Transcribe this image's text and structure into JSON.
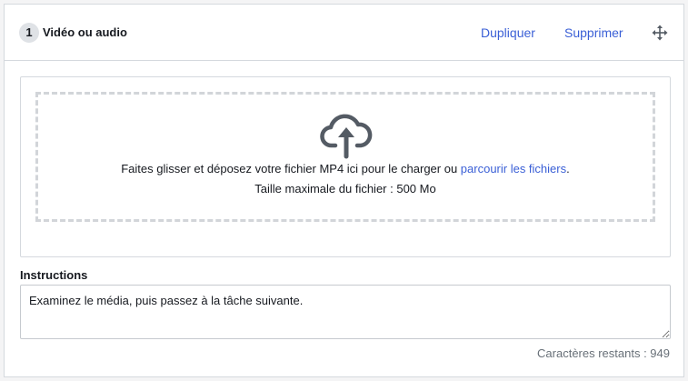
{
  "header": {
    "step_number": "1",
    "title": "Vidéo ou audio",
    "duplicate_label": "Dupliquer",
    "delete_label": "Supprimer",
    "move_icon": "move-arrows-icon"
  },
  "upload": {
    "icon": "cloud-upload-icon",
    "text_before_link": "Faites glisser et déposez votre fichier MP4 ici pour le charger ou ",
    "browse_link": "parcourir les fichiers",
    "text_after_link": ".",
    "max_size_text": "Taille maximale du fichier : 500 Mo"
  },
  "instructions": {
    "label": "Instructions",
    "value": "Examinez le média, puis passez à la tâche suivante.",
    "remaining_text": "Caractères restants : 949"
  },
  "colors": {
    "link": "#3a5fd6",
    "icon": "#545b64",
    "muted": "#687078"
  }
}
